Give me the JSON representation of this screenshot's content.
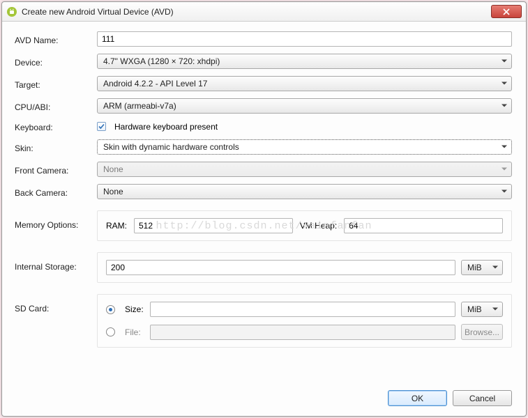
{
  "window": {
    "title": "Create new Android Virtual Device (AVD)"
  },
  "labels": {
    "avd_name": "AVD Name:",
    "device": "Device:",
    "target": "Target:",
    "cpu_abi": "CPU/ABI:",
    "keyboard": "Keyboard:",
    "skin": "Skin:",
    "front_camera": "Front Camera:",
    "back_camera": "Back Camera:",
    "memory_options": "Memory Options:",
    "internal_storage": "Internal Storage:",
    "sd_card": "SD Card:",
    "ram": "RAM:",
    "vm_heap": "VM Heap:",
    "size": "Size:",
    "file": "File:"
  },
  "values": {
    "avd_name": "111",
    "device": "4.7\" WXGA (1280 × 720: xhdpi)",
    "target": "Android 4.2.2 - API Level 17",
    "cpu_abi": "ARM (armeabi-v7a)",
    "keyboard_checkbox": "Hardware keyboard present",
    "keyboard_checked": true,
    "skin": "Skin with dynamic hardware controls",
    "front_camera": "None",
    "back_camera": "None",
    "ram": "512",
    "vm_heap": "64",
    "internal_storage": "200",
    "internal_storage_unit": "MiB",
    "sd_size": "",
    "sd_size_unit": "MiB",
    "sd_file": "",
    "sd_selected": "size"
  },
  "buttons": {
    "ok": "OK",
    "cancel": "Cancel",
    "browse": "Browse..."
  },
  "watermark": "http://blog.csdn.net/vainfanfan"
}
